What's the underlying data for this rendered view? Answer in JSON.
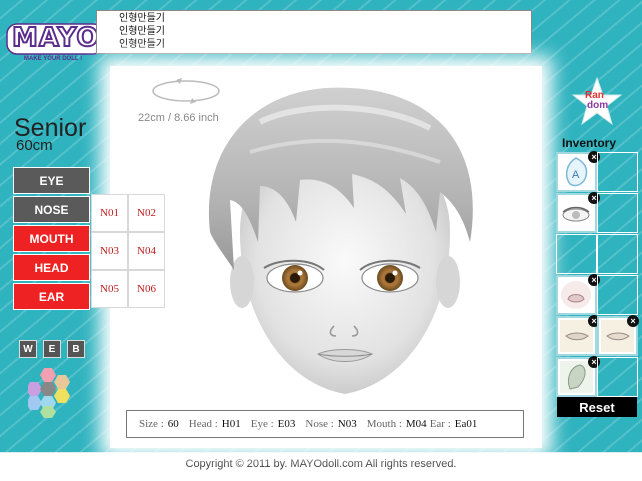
{
  "logo": {
    "brand": "MAYO",
    "tagline": "MAKE YOUR DOLL !"
  },
  "notice": {
    "lines": [
      "인형만들기",
      "인형만들기",
      "인형만들기"
    ]
  },
  "preview": {
    "size_label": "22cm / 8.66 inch"
  },
  "left_panel": {
    "category": "Senior",
    "height": "60cm",
    "buttons": [
      {
        "label": "EYE",
        "state": "inactive"
      },
      {
        "label": "NOSE",
        "state": "selected"
      },
      {
        "label": "MOUTH",
        "state": "active"
      },
      {
        "label": "HEAD",
        "state": "active"
      },
      {
        "label": "EAR",
        "state": "active"
      }
    ],
    "options": [
      "N01",
      "N02",
      "N03",
      "N04",
      "N05",
      "N06"
    ],
    "web_buttons": [
      "W",
      "E",
      "B"
    ]
  },
  "right_panel": {
    "random_label_1": "Ran",
    "random_label_2": "dom",
    "inventory_title": "Inventory",
    "remove_glyph": "×",
    "reset_label": "Reset"
  },
  "status": {
    "size_key": "Size :",
    "size_val": "60",
    "head_key": "Head :",
    "head_val": "H01",
    "eye_key": "Eye :",
    "eye_val": "E03",
    "nose_key": "Nose :",
    "nose_val": "N03",
    "mouth_key": "Mouth :",
    "mouth_val": "M04",
    "ear_key": "Ear :",
    "ear_val": "Ea01"
  },
  "footer": {
    "copyright": "Copyright © 2011 by. MAYOdoll.com  All rights reserved."
  },
  "colors": {
    "background": "#2fb3bf",
    "accent_red": "#ee2222",
    "button_gray": "#5a5a5a",
    "brand_purple": "#5b2c8c"
  }
}
